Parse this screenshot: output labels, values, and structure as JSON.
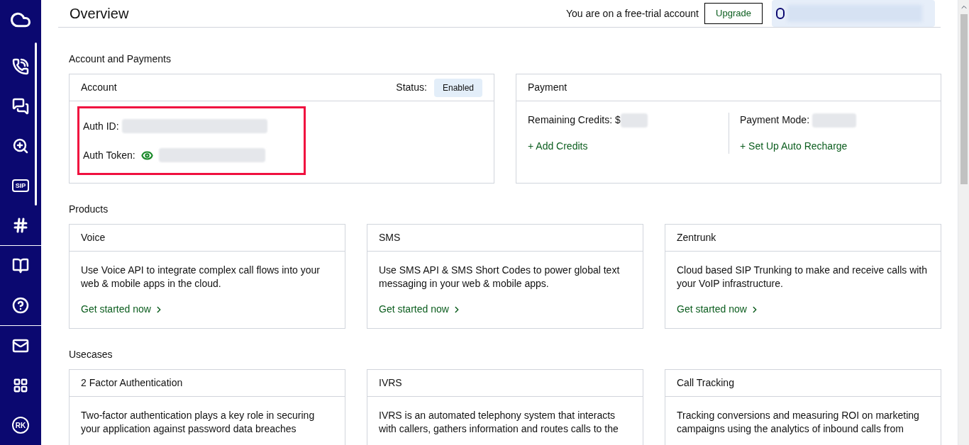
{
  "sidebar": {
    "sip_label": "SIP",
    "avatar_initials": "RK"
  },
  "header": {
    "title": "Overview",
    "trial_notice": "You are on a free-trial account",
    "upgrade_button": "Upgrade"
  },
  "account_section": {
    "heading": "Account and Payments",
    "account": {
      "title": "Account",
      "status_label": "Status:",
      "status": "Enabled",
      "auth_id_label": "Auth ID:",
      "auth_token_label": "Auth Token:",
      "highlighted": true
    },
    "payment": {
      "title": "Payment",
      "credits_label": "Remaining Credits: $",
      "add_credits_link": "+ Add Credits",
      "mode_label": "Payment Mode:",
      "auto_recharge_link": "+ Set Up Auto Recharge"
    }
  },
  "products": {
    "heading": "Products",
    "cards": [
      {
        "title": "Voice",
        "description": "Use Voice API to integrate complex call flows into your web & mobile apps in the cloud.",
        "link": "Get started now"
      },
      {
        "title": "SMS",
        "description": "Use SMS API & SMS Short Codes to power global text messaging in your web & mobile apps.",
        "link": "Get started now"
      },
      {
        "title": "Zentrunk",
        "description": "Cloud based SIP Trunking to make and receive calls with your VoIP infrastructure.",
        "link": "Get started now"
      }
    ]
  },
  "usecases": {
    "heading": "Usecases",
    "cards": [
      {
        "title": "2 Factor Authentication",
        "description": "Two-factor authentication plays a key role in securing your application against password data breaches"
      },
      {
        "title": "IVRS",
        "description": "IVRS is an automated telephony system that interacts with callers, gathers information and routes calls to the"
      },
      {
        "title": "Call Tracking",
        "description": "Tracking conversions and measuring ROI on marketing campaigns using the analytics of inbound calls from"
      }
    ]
  }
}
